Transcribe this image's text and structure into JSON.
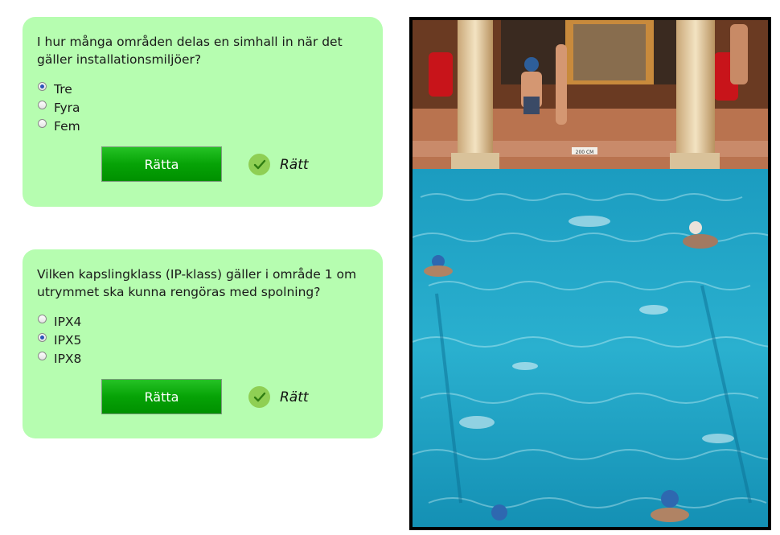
{
  "quiz1": {
    "question": "I hur många områden delas en simhall in när det gäller installationsmiljöer?",
    "options": [
      "Tre",
      "Fyra",
      "Fem"
    ],
    "selected_index": 0,
    "submit_label": "Rätta",
    "feedback": "Rätt"
  },
  "quiz2": {
    "question": "Vilken kapslingklass (IP-klass) gäller i område 1 om utrymmet ska kunna rengöras med spolning?",
    "options": [
      "IPX4",
      "IPX5",
      "IPX8"
    ],
    "selected_index": 1,
    "submit_label": "Rätta",
    "feedback": "Rätt"
  },
  "photo": {
    "subject": "indoor swimming pool with swimmers and columns",
    "sign_text": "200 CM"
  },
  "colors": {
    "panel": "#b6fdb0",
    "button": "#06a306",
    "check": "#8fcf54",
    "pool": "#1a9ab8"
  }
}
